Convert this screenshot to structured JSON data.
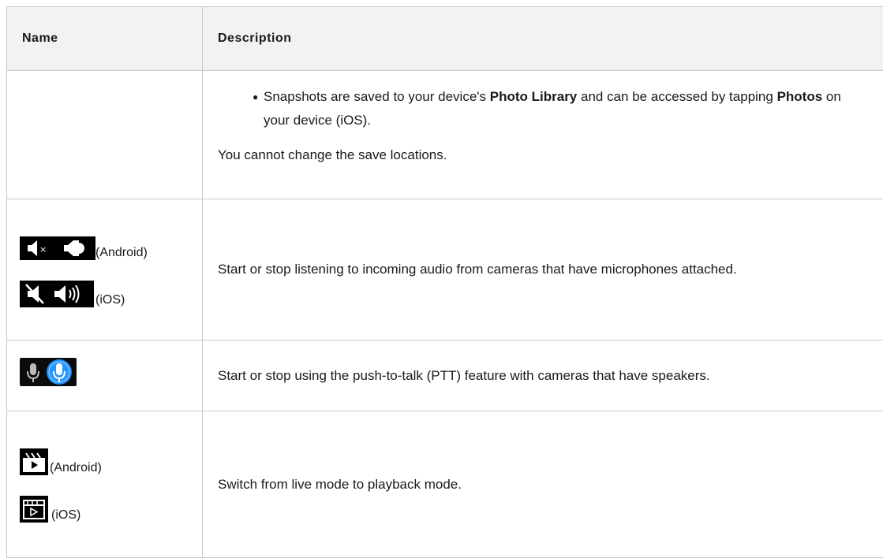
{
  "table": {
    "headers": {
      "name": "Name",
      "description": "Description"
    },
    "row_snapshots": {
      "bullet": {
        "part1": "Snapshots are saved to your device's ",
        "bold1": "Photo Library",
        "part2": " and can be accessed by tapping ",
        "bold2": "Photos",
        "part3": " on your device (iOS)."
      },
      "note": "You cannot change the save locations."
    },
    "row_audio": {
      "android_label": "(Android)",
      "ios_label": "(iOS)",
      "description": "Start or stop listening to incoming audio from cameras that have microphones attached.",
      "android_icon": "mute-unmute-speaker-icon",
      "ios_icon": "muted-speaker-speaker-waves-icon"
    },
    "row_ptt": {
      "description": "Start or stop using the push-to-talk (PTT) feature with cameras that have speakers.",
      "icon": "microphone-icon"
    },
    "row_playback": {
      "android_label": "(Android)",
      "ios_label": "(iOS)",
      "description": "Switch from live mode to playback mode.",
      "android_icon": "clapperboard-play-icon",
      "ios_icon": "clapperboard-play-outline-icon"
    }
  },
  "colors": {
    "header_bg": "#f2f2f2",
    "border": "#c8c8c8",
    "icon_bg": "#000000",
    "mic_active": "#1e90ff"
  }
}
